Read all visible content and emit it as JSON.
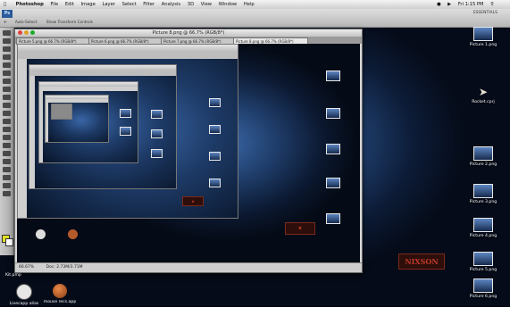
{
  "menubar": {
    "app_name": "Photoshop",
    "items": [
      "File",
      "Edit",
      "Image",
      "Layer",
      "Select",
      "Filter",
      "Analysis",
      "3D",
      "View",
      "Window",
      "Help"
    ],
    "clock": "Fri 1:15 PM"
  },
  "optionsbar": {
    "workspace": "ESSENTIALS",
    "auto_select": "Auto-Select:",
    "show_transform": "Show Transform Controls",
    "zoom": "66.7%"
  },
  "document": {
    "title": "Picture 8.png @ 66.7% (RGB/8*)",
    "tabs": [
      "Picture 5.png @ 66.7% (RGB/8*)",
      "Picture 6.png @ 66.7% (RGB/8*)",
      "Picture 7.png @ 66.7% (RGB/8*)",
      "Picture 8.png @ 66.7% (RGB/8*)"
    ],
    "status_zoom": "66.67%",
    "status_doc": "Doc: 2.73M/3.71M"
  },
  "desktop": {
    "icons": [
      "Picture 1.png",
      "Picture 2.png",
      "Picture 3.png",
      "Picture 4.png",
      "Picture 5.png",
      "Picture 6.png"
    ],
    "rocket_label": "Rocket.cprj",
    "dock_label": "Kit.pmp",
    "logo_text": "NIXSON",
    "apps": [
      "Livecapp alias",
      "mouse recs.app"
    ]
  },
  "colors": {
    "accent": "#2a5a9a",
    "foreground_swatch": "#e1df2a"
  }
}
